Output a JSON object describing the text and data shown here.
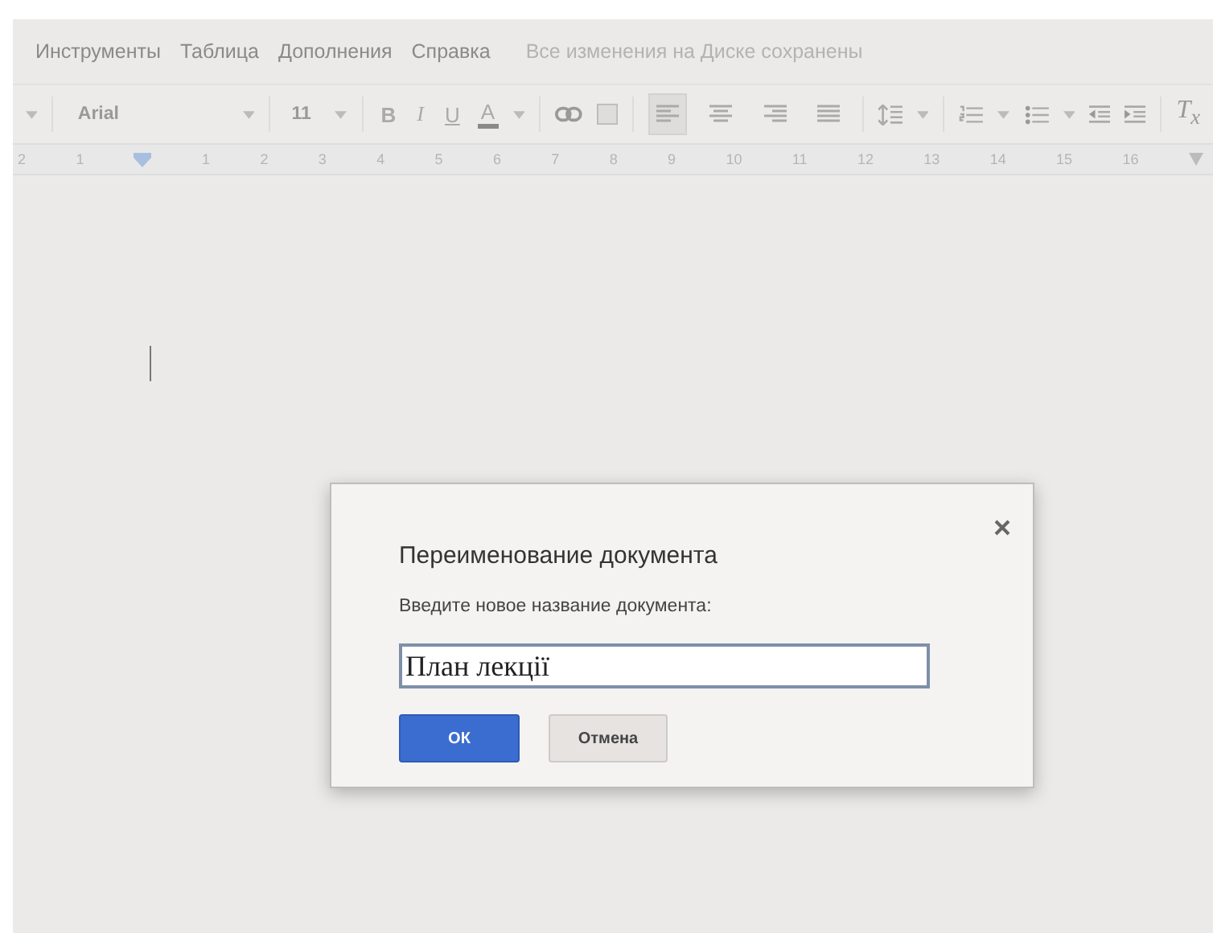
{
  "menu": [
    {
      "label": "Инструменты"
    },
    {
      "label": "Таблица"
    },
    {
      "label": "Дополнения"
    },
    {
      "label": "Справка"
    }
  ],
  "save_status": "Все изменения на Диске сохранены",
  "toolbar": {
    "font": "Arial",
    "size": "11",
    "format": [
      {
        "label": "B",
        "kind": "bold"
      },
      {
        "label": "I",
        "kind": "italic"
      },
      {
        "label": "U",
        "kind": "underline"
      },
      {
        "label": "A",
        "kind": "color"
      }
    ],
    "align": [
      {
        "selected": true
      },
      {
        "selected": false
      },
      {
        "selected": false
      },
      {
        "selected": false
      }
    ],
    "clear_format": "T$_{x}$"
  },
  "ruler": [
    "2",
    "1",
    "1",
    "2",
    "3",
    "4",
    "5",
    "6",
    "7",
    "8",
    "9",
    "10",
    "11",
    "12",
    "13",
    "14",
    "15",
    "16"
  ],
  "dialog": {
    "title": "Переименование документа",
    "prompt": "Введите новое название документа:",
    "value": "План лекції",
    "buttons": [
      {
        "label": "ОК",
        "kind": "primary"
      },
      {
        "label": "Отмена",
        "kind": "secondary"
      }
    ]
  }
}
